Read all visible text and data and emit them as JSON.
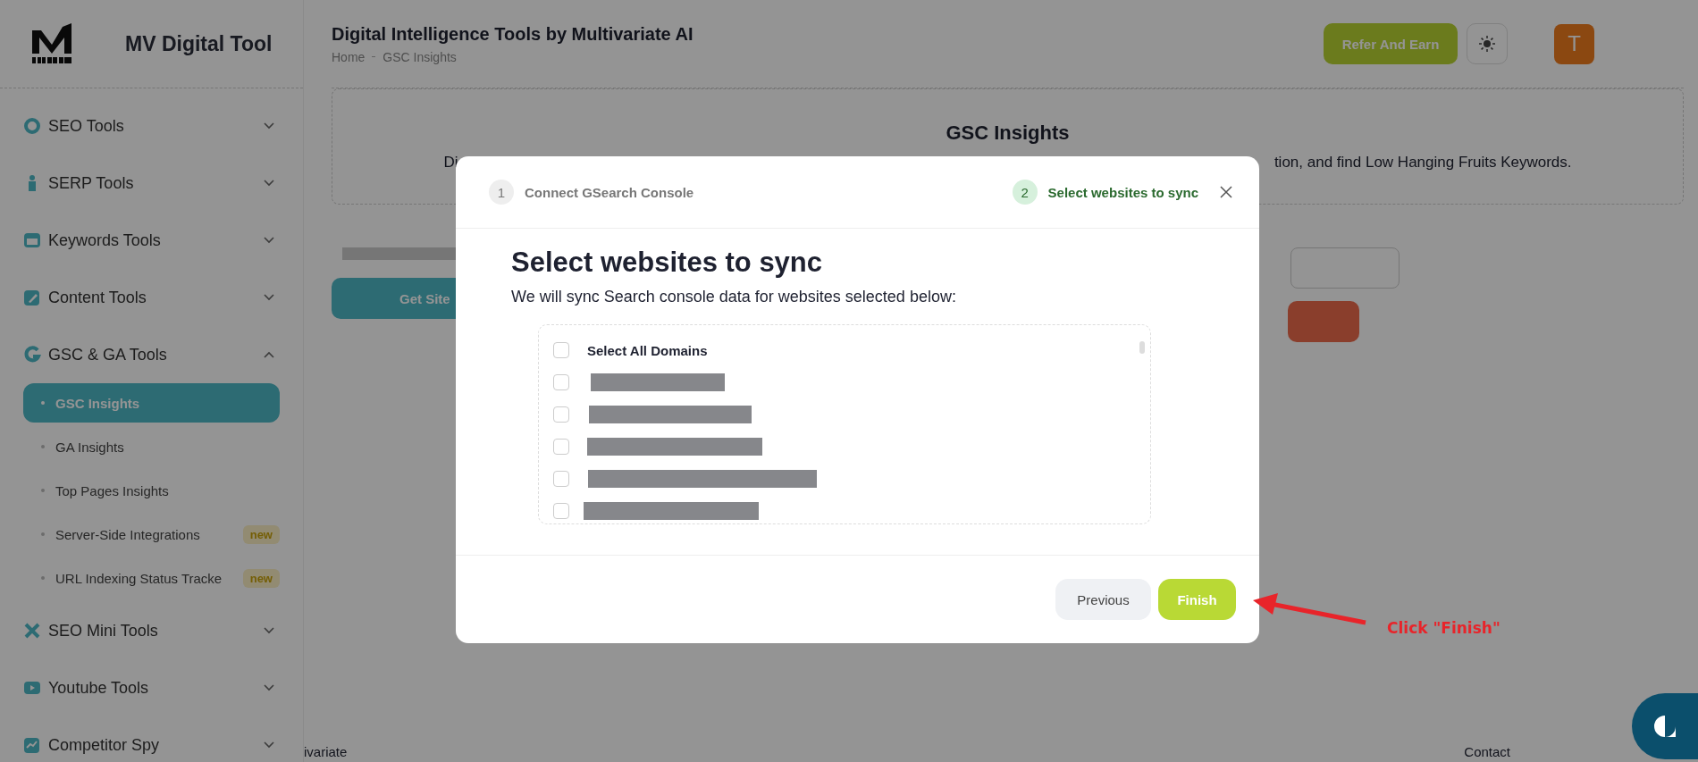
{
  "sidebar": {
    "brand": "MV Digital Tool",
    "items": [
      {
        "label": "SEO Tools",
        "expanded": false
      },
      {
        "label": "SERP Tools",
        "expanded": false
      },
      {
        "label": "Keywords Tools",
        "expanded": false
      },
      {
        "label": "Content Tools",
        "expanded": false
      },
      {
        "label": "GSC & GA Tools",
        "expanded": true,
        "children": [
          {
            "label": "GSC Insights",
            "selected": true
          },
          {
            "label": "GA Insights",
            "selected": false
          },
          {
            "label": "Top Pages Insights",
            "selected": false
          },
          {
            "label": "Server-Side Integrations",
            "selected": false,
            "badge": "new"
          },
          {
            "label": "URL Indexing Status Tracke",
            "selected": false,
            "badge": "new"
          }
        ]
      },
      {
        "label": "SEO Mini Tools",
        "expanded": false
      },
      {
        "label": "Youtube Tools",
        "expanded": false
      },
      {
        "label": "Competitor Spy",
        "expanded": false
      }
    ]
  },
  "header": {
    "title": "Digital Intelligence Tools by Multivariate AI",
    "breadcrumb": [
      "Home",
      "GSC Insights"
    ],
    "refer_button": "Refer And Earn",
    "avatar": "T"
  },
  "page": {
    "card_title": "GSC Insights",
    "description_start": "Di",
    "description_end": "tion, and find Low Hanging Fruits Keywords.",
    "get_button": "Get Site"
  },
  "footer": {
    "left": "ivariate",
    "right": "Contact"
  },
  "modal": {
    "steps": [
      {
        "number": "1",
        "label": "Connect GSearch Console",
        "selected": false
      },
      {
        "number": "2",
        "label": "Select websites to sync",
        "selected": true
      }
    ],
    "heading": "Select websites to sync",
    "subtitle": "We will sync Search console data for websites selected below:",
    "select_all": {
      "label": "Select All Domains",
      "checked": false
    },
    "domains": [
      {
        "checked": false
      },
      {
        "checked": false
      },
      {
        "checked": false
      },
      {
        "checked": false
      },
      {
        "checked": false
      }
    ],
    "buttons": [
      {
        "label": "Previous",
        "kind": "secondary"
      },
      {
        "label": "Finish",
        "kind": "primary"
      }
    ]
  },
  "annotation": {
    "text": "Click \"Finish\""
  }
}
